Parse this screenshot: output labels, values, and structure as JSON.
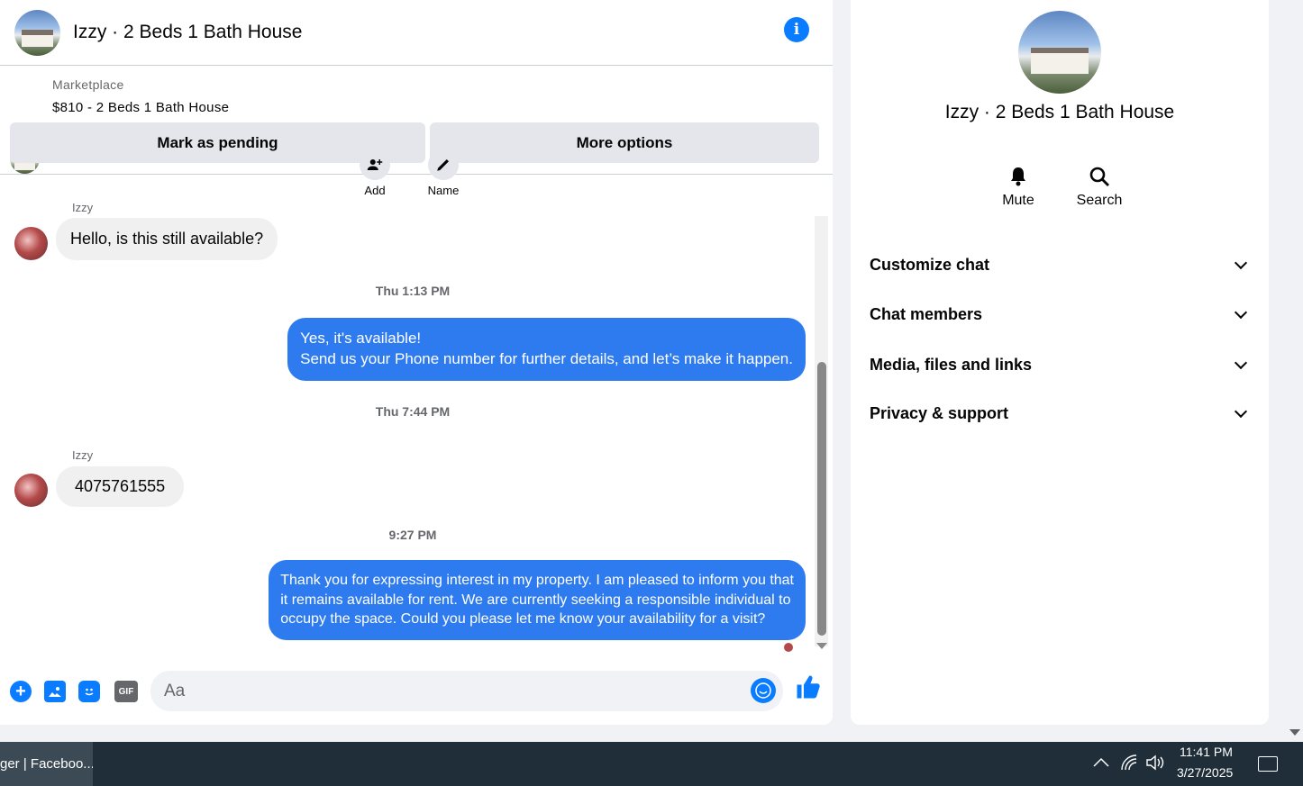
{
  "header": {
    "title": "Izzy · 2 Beds 1 Bath House",
    "info_icon": "info-icon"
  },
  "listing": {
    "label": "Marketplace",
    "title": "$810 - 2 Beds 1 Bath House",
    "buttons": {
      "pending": "Mark as pending",
      "more": "More options"
    }
  },
  "mini_actions": [
    {
      "label": "Add",
      "icon": "add-person-icon"
    },
    {
      "label": "Name",
      "icon": "pencil-icon"
    }
  ],
  "messages": {
    "m1": {
      "sender": "Izzy",
      "text": "Hello, is this still available?"
    },
    "t1": "Thu 1:13 PM",
    "m2": {
      "line1": "Yes, it's available!",
      "line2": "Send us your Phone number for further details, and let’s make it happen."
    },
    "t2": "Thu 7:44 PM",
    "m3": {
      "sender": "Izzy",
      "text": "4075761555"
    },
    "t3": "9:27 PM",
    "m4": {
      "line1": "Thank you for expressing interest in my property. I am pleased to inform you that",
      "line2": "it remains available for rent. We are currently seeking a responsible individual to",
      "line3": "occupy the space. Could you please let me know your availability for a visit?"
    }
  },
  "composer": {
    "placeholder": "Aa",
    "gif_label": "GIF"
  },
  "side": {
    "title": "Izzy · 2 Beds 1 Bath House",
    "actions": {
      "mute": "Mute",
      "search": "Search"
    },
    "sections": [
      "Customize chat",
      "Chat members",
      "Media, files and links",
      "Privacy & support"
    ]
  },
  "taskbar": {
    "app_label": "ger | Faceboo...",
    "time": "11:41 PM",
    "date": "3/27/2025"
  },
  "colors": {
    "accent": "#0a7cff",
    "outgoing_bubble": "#2e7bf0",
    "incoming_bubble": "#f0f0f0",
    "taskbar": "#1f2e38"
  }
}
